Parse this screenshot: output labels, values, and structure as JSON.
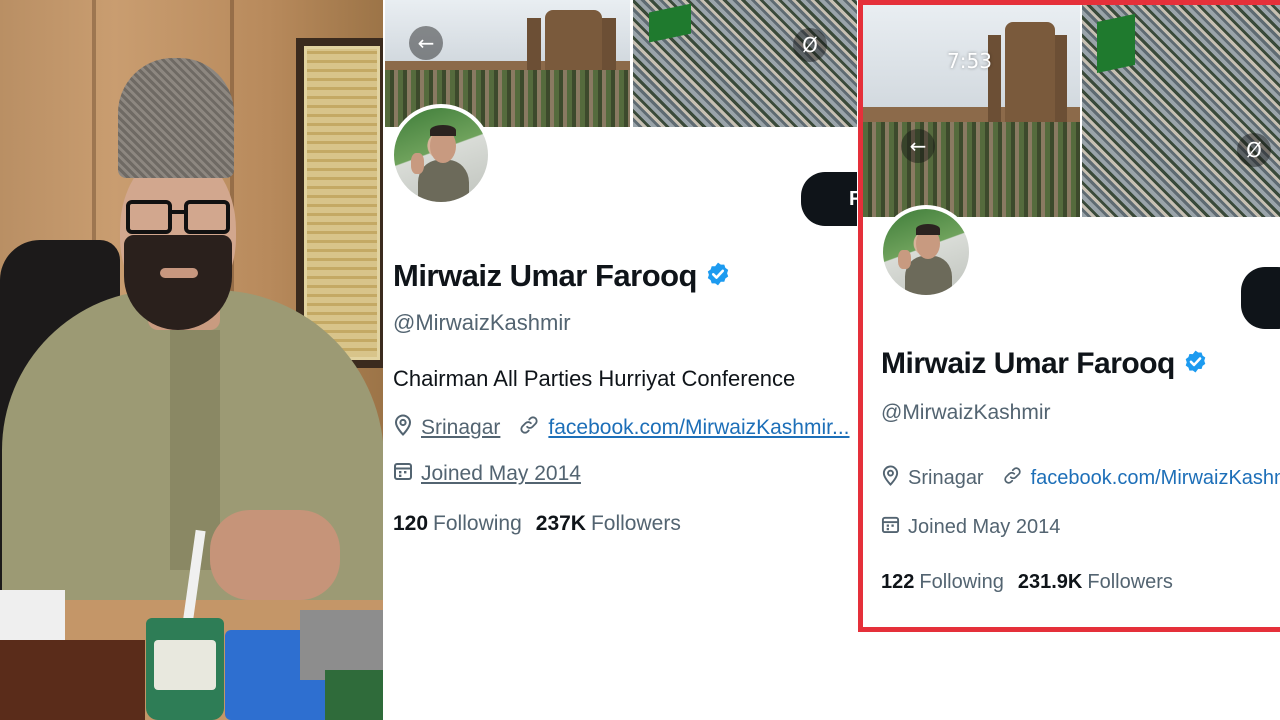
{
  "left_photo": {
    "icon": "person-at-desk-photo"
  },
  "profile_a": {
    "name": "Mirwaiz Umar Farooq",
    "handle": "@MirwaizKashmir",
    "bio": "Chairman All Parties Hurriyat Conference",
    "location": "Srinagar",
    "website": "facebook.com/MirwaizKashmir...",
    "joined": "Joined May 2014",
    "following_count": "120",
    "following_label": "Following",
    "followers_count": "237K",
    "followers_label": "Followers",
    "follow_button_label": "F",
    "back_icon": "←",
    "mute_icon": "Ø"
  },
  "profile_b": {
    "status_time": "7:53",
    "name": "Mirwaiz Umar Farooq",
    "handle": "@MirwaizKashmir",
    "location": "Srinagar",
    "website": "facebook.com/MirwaizKashmir...",
    "joined": "Joined May 2014",
    "following_count": "122",
    "following_label": "Following",
    "followers_count": "231.9K",
    "followers_label": "Followers",
    "back_icon": "←",
    "mute_icon": "Ø"
  },
  "colors": {
    "highlight_border": "#e5303a",
    "verified_blue": "#1d9bf0",
    "link_blue": "#1d6fb8",
    "muted_text": "#536471"
  }
}
